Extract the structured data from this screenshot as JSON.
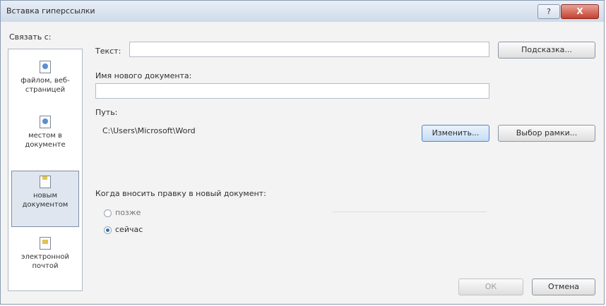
{
  "window": {
    "title": "Вставка гиперссылки",
    "help_label": "?",
    "close_label": "X"
  },
  "link_to": {
    "label": "Связать с:",
    "items": [
      {
        "label_line1": "файлом, веб-",
        "label_line2": "страницей",
        "icon": "file-web-icon",
        "selected": false
      },
      {
        "label_line1": "местом в",
        "label_line2": "документе",
        "icon": "place-in-document-icon",
        "selected": false
      },
      {
        "label_line1": "новым",
        "label_line2": "документом",
        "icon": "new-document-icon",
        "selected": true
      },
      {
        "label_line1": "электронной",
        "label_line2": "почтой",
        "icon": "email-icon",
        "selected": false
      }
    ]
  },
  "form": {
    "text_label": "Текст:",
    "text_value": "",
    "hint_button": "Подсказка...",
    "new_doc_name_label": "Имя нового документа:",
    "new_doc_name_value": "",
    "path_label": "Путь:",
    "path_value": "C:\\Users\\Microsoft\\Word",
    "change_button": "Изменить...",
    "frame_button": "Выбор рамки...",
    "when_edit_label": "Когда вносить правку в новый документ:",
    "option_later": "позже",
    "option_now": "сейчас",
    "selected_option": "now"
  },
  "footer": {
    "ok_button": "ОК",
    "cancel_button": "Отмена"
  },
  "colors": {
    "title_bar": "#cfdbea",
    "close_button": "#c5402f",
    "selected_nav": "#dfe6ef"
  }
}
